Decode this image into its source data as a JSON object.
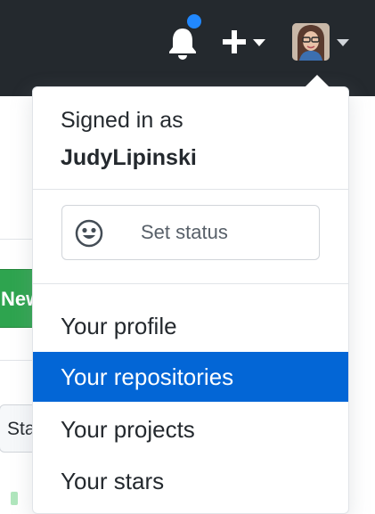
{
  "header": {
    "notifications_icon": "bell-icon",
    "notification_indicator_color": "#2188ff",
    "create_icon": "plus-icon",
    "avatar_icon": "user-avatar"
  },
  "background": {
    "new_button_label": "New",
    "star_button_label": "Sta"
  },
  "dropdown": {
    "signed_in_label": "Signed in as",
    "username": "JudyLipinski",
    "status": {
      "icon": "smiley-icon",
      "label": "Set status"
    },
    "items": [
      {
        "label": "Your profile",
        "active": false
      },
      {
        "label": "Your repositories",
        "active": true
      },
      {
        "label": "Your projects",
        "active": false
      },
      {
        "label": "Your stars",
        "active": false
      }
    ]
  },
  "colors": {
    "header_bg": "#24292e",
    "active_item_bg": "#0366d6",
    "new_button_bg": "#2ea44f"
  }
}
